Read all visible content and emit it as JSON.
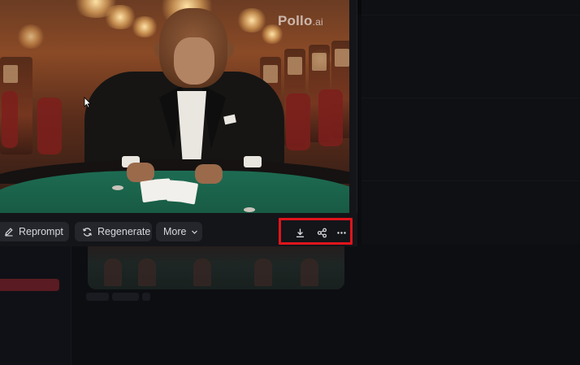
{
  "watermark": {
    "brand": "Pollo",
    "suffix": ".ai"
  },
  "toolbar": {
    "reprompt_label": "Reprompt",
    "regenerate_label": "Regenerate",
    "more_label": "More"
  },
  "actions": {
    "download_icon": "download-icon",
    "share_icon": "share-icon",
    "more_icon": "more-horizontal-icon"
  },
  "colors": {
    "highlight": "#e0141b",
    "button_bg": "#25262c",
    "panel_bg": "#141519"
  }
}
